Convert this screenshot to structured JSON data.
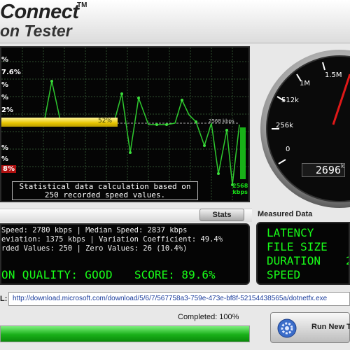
{
  "header": {
    "brand": "Connect",
    "trademark": "TM",
    "subtitle": "on Tester"
  },
  "graph": {
    "percent_labels": [
      "%",
      "7.6%",
      "%",
      "%",
      "2%",
      "%",
      "%",
      "8%"
    ],
    "speed_bar_label": "52%",
    "average_line_label": "2568 kbps",
    "note_line1": "Statistical data calculation based on",
    "note_line2": "250 recorded speed values.",
    "max_value": "2568",
    "max_unit": "kbps"
  },
  "gauge": {
    "tick_labels": [
      "0",
      "256k",
      "512k",
      "1M",
      "1.5M"
    ],
    "readout_value": "2696",
    "readout_unit": "k"
  },
  "stats": {
    "button_label": "Stats",
    "line1": " Speed: 2780 kbps | Median Speed: 2837 kbps",
    "line2": "eviation: 1375 kbps | Variation Coefficient: 49.4%",
    "line3": "rded Values: 250 | Zero Values: 26 (10.4%)",
    "quality": "ON QUALITY: GOOD",
    "score": "SCORE: 89.6%"
  },
  "measured": {
    "title": "Measured Data",
    "labels": [
      "LATENCY",
      "FILE SIZE",
      "DURATION",
      "SPEED"
    ],
    "duration_value": "2"
  },
  "download": {
    "url_label": "L:",
    "url": "http://download.microsoft.com/download/5/6/7/567758a3-759e-473e-bf8f-52154438565a/dotnetfx.exe",
    "completed_text": "Completed: 100%",
    "progress_percent": 100
  },
  "run_button": {
    "label": "Run New T"
  },
  "colors": {
    "lcd_green": "#18ff18",
    "bar_yellow": "#e6c400",
    "progress_green": "#19b019"
  }
}
